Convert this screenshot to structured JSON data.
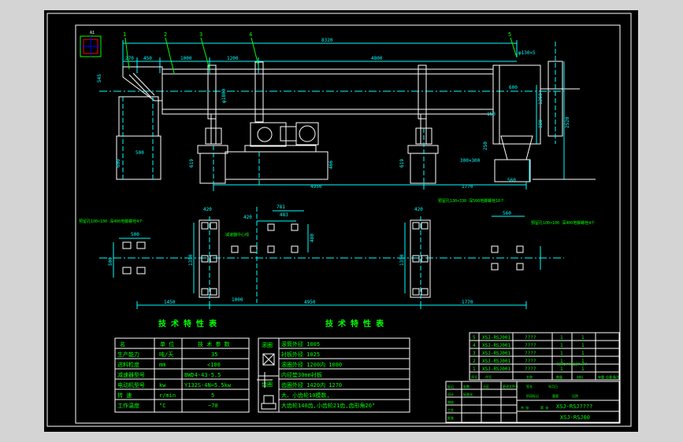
{
  "colors": {
    "sheet": "#000000",
    "frame": "#ffffff",
    "geometry": "#ffffff",
    "dimension": "#00ffff",
    "centerline": "#00ffff",
    "title_text": "#00ff00",
    "leader": "#00ff00",
    "note": "#00ff00",
    "accent_red": "#ff0000",
    "accent_blue": "#0000ff",
    "background": "#d4d4d4"
  },
  "balloons": [
    "1",
    "2",
    "3",
    "4",
    "5"
  ],
  "elevation_dims": {
    "overall": "8320",
    "d270": "270",
    "d450": "450",
    "d1000": "1000",
    "d1200": "1200",
    "d1800": "1800",
    "d4800": "4800",
    "flange": "φ130×5",
    "h545": "545",
    "dia1800": "φ1800",
    "h600_right": "600",
    "h1260": "1260",
    "h150": "150",
    "h180": "180",
    "h2520": "2520",
    "h250": "250",
    "hopper": "300×300",
    "w560_base": "560",
    "h600_left": "600",
    "w500_left": "500",
    "h619_a": "619",
    "h466": "466",
    "h619_b": "619",
    "d4950": "4950",
    "d1770": "1770"
  },
  "plan_dims": {
    "w500": "500",
    "h500": "500",
    "w420_a": "420",
    "h1350_a": "1350",
    "w420_b": "420",
    "w781": "781",
    "w483": "483",
    "h480": "480",
    "w1000": "1000",
    "w420_c": "420",
    "h1350_b": "1350",
    "w560": "560",
    "d1450": "1450",
    "d4950": "4950",
    "d1770": "1770"
  },
  "plan_notes": {
    "left": "预留孔100×100\n深400地脚螺栓4个",
    "mid": "减速器中心线",
    "right_top": "预留孔130×330\n深500地脚螺栓16个",
    "right": "预留孔100×100\n深400地脚螺栓4个"
  },
  "spec_table_1": {
    "heading": "技 术 特 性 表",
    "header": [
      "名",
      "称",
      "单 位",
      "技 术 参 数"
    ],
    "rows": [
      {
        "name": "生产能力",
        "unit": "吨/天",
        "value": "35"
      },
      {
        "name": "进料粒度",
        "unit": "mm",
        "value": "<100"
      },
      {
        "name": "减速器型号",
        "unit": "",
        "value": "BWD4-43-5.5"
      },
      {
        "name": "电动机型号",
        "unit": "kw",
        "value": "Y132S-4N=5.5kw"
      },
      {
        "name": "转    速",
        "unit": "r/min",
        "value": "5"
      },
      {
        "name": "工作温度",
        "unit": "°C",
        "value": "~70"
      }
    ]
  },
  "spec_table_2": {
    "heading": "技 术 特 性 表",
    "side_labels": [
      "滚圈",
      "齿圈"
    ],
    "rows": [
      "滚筒外径 1005",
      "衬板外径 1025",
      "滚圈外径  1200内  1080",
      "内径垫30mm衬板",
      "齿圈外径  1420内  1270",
      "大、小齿轮10模数,",
      "大齿轮140齿,小齿轮21齿,齿形角20°"
    ]
  },
  "bom": {
    "rows": [
      {
        "no": "5",
        "code": "XSJ-RSJ001",
        "name": "????",
        "qty": "1",
        "mat": "1"
      },
      {
        "no": "4",
        "code": "XSJ-RSJ001",
        "name": "????",
        "qty": "1",
        "mat": "1"
      },
      {
        "no": "3",
        "code": "XSJ-RSJ001",
        "name": "????",
        "qty": "1",
        "mat": "1"
      },
      {
        "no": "2",
        "code": "XSJ-RSJ001",
        "name": "????",
        "qty": "1",
        "mat": "1"
      },
      {
        "no": "1",
        "code": "XSJ-RSJ001",
        "name": "????",
        "qty": "1",
        "mat": "1"
      }
    ],
    "side_note": "?0?t???10?×??",
    "header_labels": [
      "序号",
      "代号",
      "名称",
      "数量",
      "材料",
      "单重",
      "总重",
      "备注"
    ]
  },
  "title_block": {
    "row1": [
      "标记",
      "处数",
      "分区",
      "更改文件号",
      "签名",
      "年月日"
    ],
    "row2": [
      "设计",
      "标准化",
      "阶段标记",
      "重量",
      "比例"
    ],
    "title": "XSJ-RSJ????",
    "drawing_no": "XSJ-RSJ00",
    "small_labels": [
      "审核",
      "工艺",
      "批准",
      "共 张",
      "第 张"
    ]
  },
  "header_mark": "A1"
}
